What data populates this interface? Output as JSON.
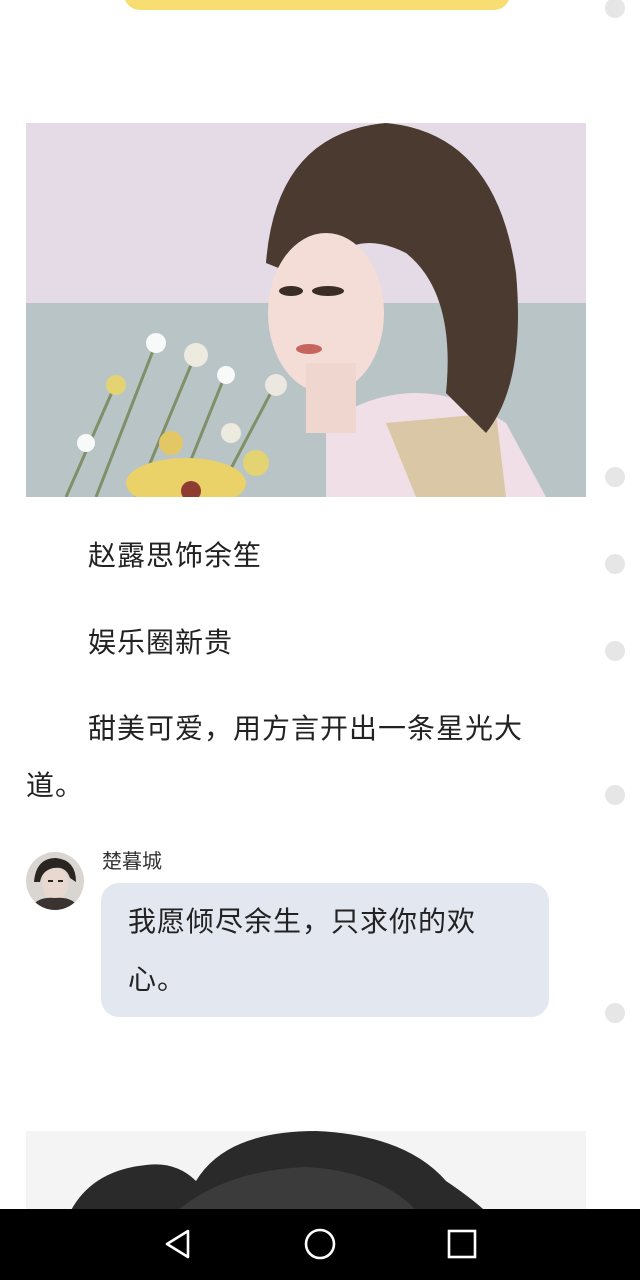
{
  "article": {
    "paragraphs": [
      "赵露思饰余笙",
      "娱乐圈新贵",
      "甜美可爱，用方言开出一条星光大道。"
    ]
  },
  "chat": {
    "speaker": "楚暮城",
    "message": "我愿倾尽余生，只求你的欢心。"
  },
  "colors": {
    "accent_yellow": "#f8dd72",
    "bubble": "#e3e7ef",
    "navbar": "#000000"
  },
  "icons": {
    "nav_back": "triangle-back-icon",
    "nav_home": "circle-home-icon",
    "nav_recent": "square-recent-icon"
  }
}
